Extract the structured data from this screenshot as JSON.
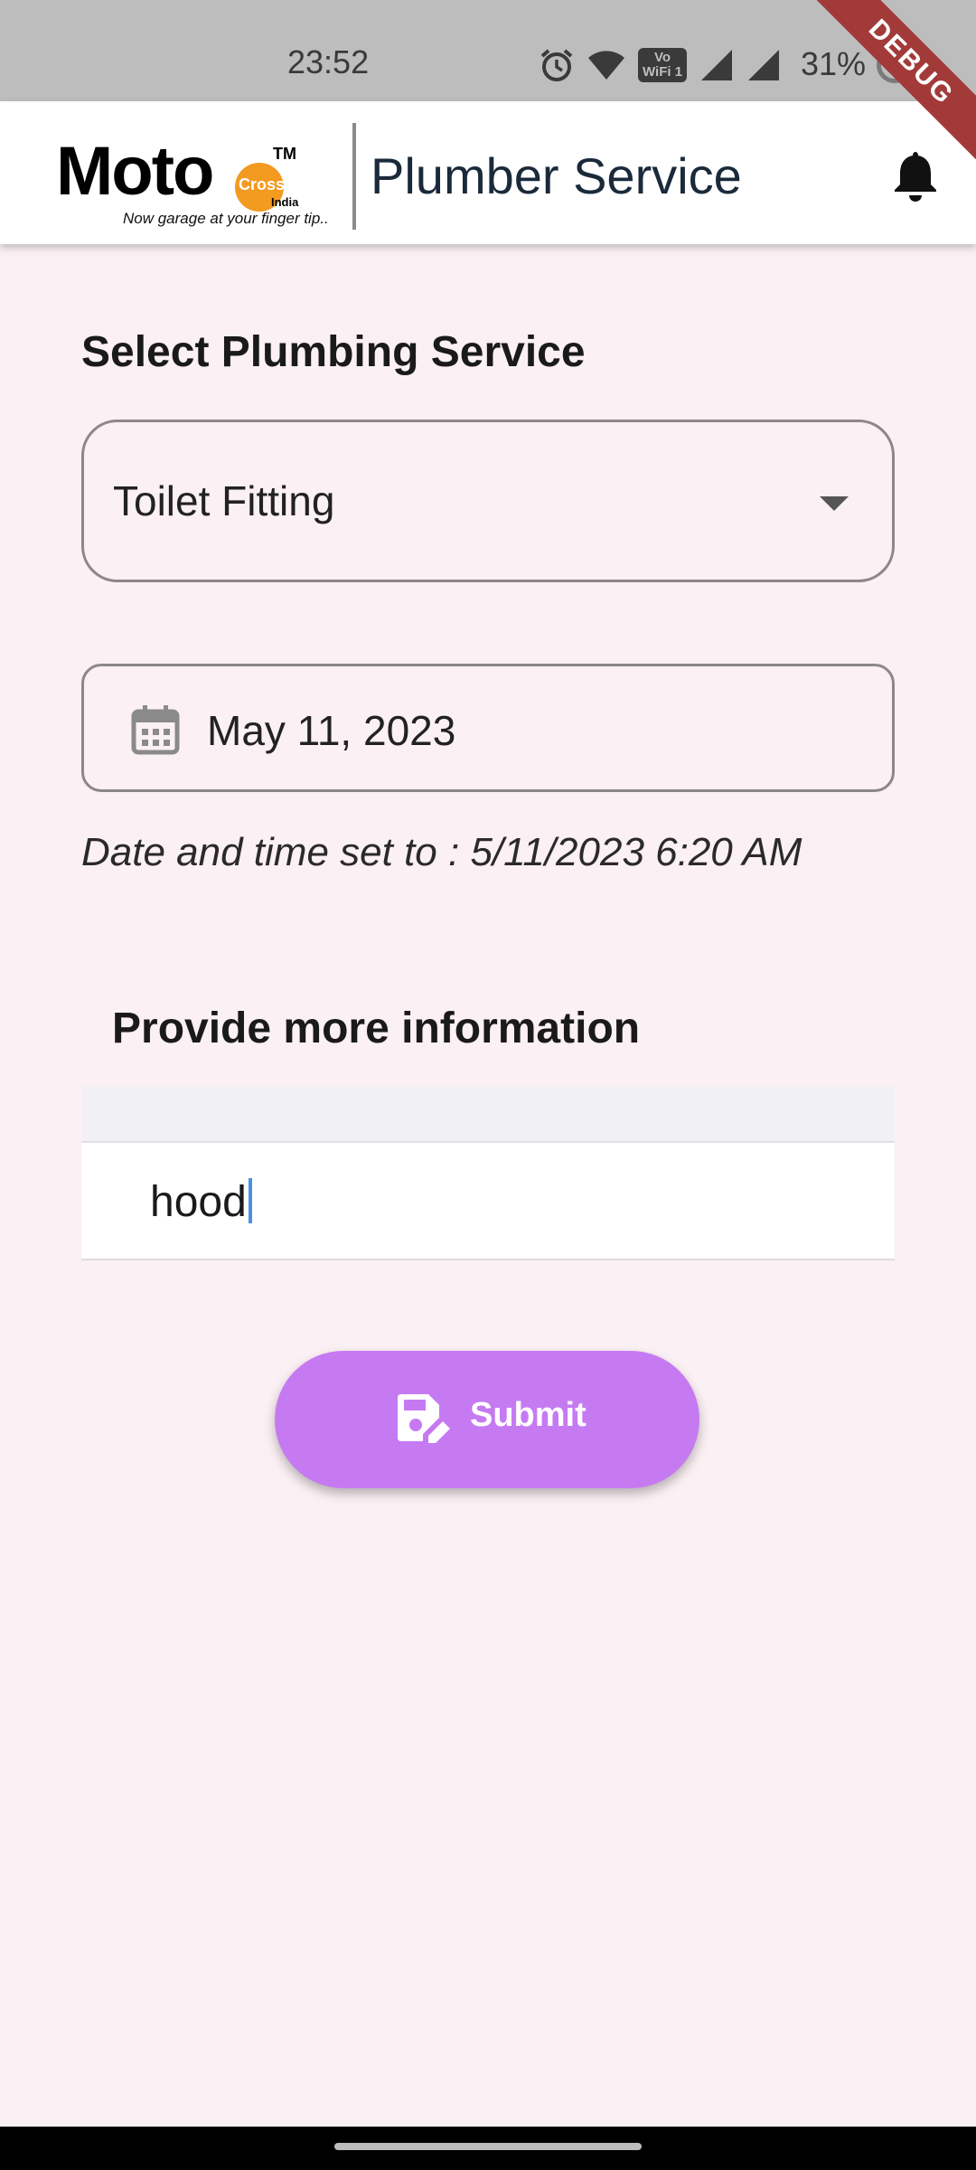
{
  "status_bar": {
    "time": "23:52",
    "wifi_badge_line1": "Vo",
    "wifi_badge_line2": "WiFi 1",
    "battery": "31%"
  },
  "debug_banner": "DEBUG",
  "app_bar": {
    "logo": {
      "main": "Moto",
      "accent": "Cross",
      "tm": "TM",
      "sub": "India",
      "tagline": "Now garage at your finger tip.."
    },
    "title": "Plumber Service",
    "notification_icon": "bell-icon"
  },
  "form": {
    "service_section_title": "Select Plumbing Service",
    "service_dropdown_value": "Toilet Fitting",
    "date_field_value": "May 11, 2023",
    "datetime_note": "Date and time set to : 5/11/2023 6:20 AM",
    "info_section_title": "Provide more information",
    "info_text": "hood",
    "submit_label": "Submit"
  },
  "colors": {
    "background": "#fbf0f4",
    "accent": "#c67af2",
    "logo_orange": "#f39a21",
    "debug_red": "#a33a3a"
  }
}
